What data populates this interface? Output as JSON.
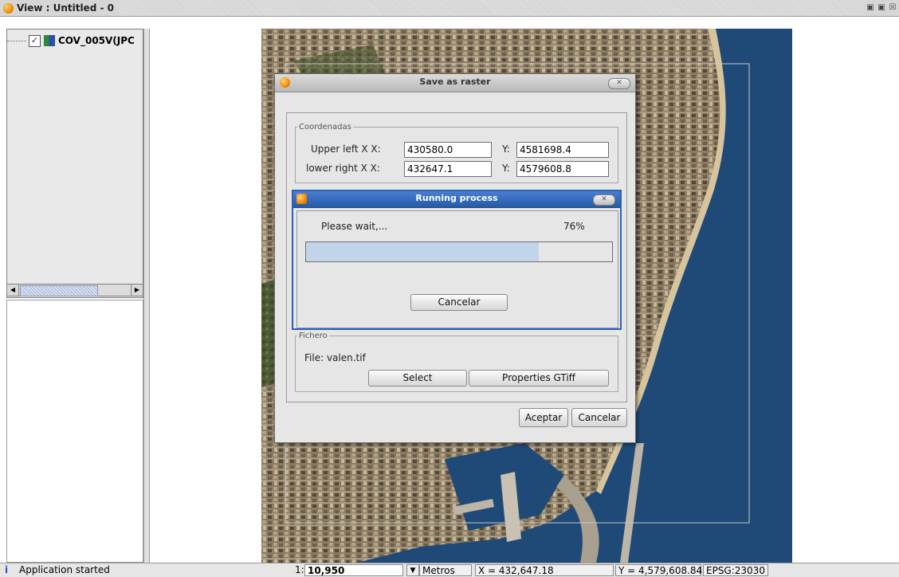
{
  "window": {
    "title": "View : Untitled - 0",
    "controls": [
      "minimize-icon",
      "maximize-icon",
      "close-icon"
    ]
  },
  "toc": {
    "layers": [
      {
        "label": "COV_005V(JPC",
        "checked": true
      }
    ]
  },
  "save_dialog": {
    "title": "Save as raster",
    "coords": {
      "legend": "Coordenadas",
      "upper_left_label": "Upper left X X:",
      "upper_left_x": "430580.0",
      "upper_left_y_label": "Y:",
      "upper_left_y": "4581698.4",
      "lower_right_label": "lower right X X:",
      "lower_right_x": "432647.1",
      "lower_right_y_label": "Y:",
      "lower_right_y": "4579608.8"
    },
    "file": {
      "legend": "Fichero",
      "file_label": "File: valen.tif",
      "select_label": "Select",
      "properties_label": "Properties GTiff"
    },
    "accept_label": "Aceptar",
    "cancel_label": "Cancelar"
  },
  "process_dialog": {
    "title": "Running process",
    "message": "Please wait,...",
    "percent_text": "76%",
    "progress": 0.76,
    "cancel_label": "Cancelar"
  },
  "status": {
    "message": "Application started",
    "scale_prefix": "1:",
    "scale_value": "10,950",
    "units": "Metros",
    "x_coord": "X = 432,647.18",
    "y_coord": "Y = 4,579,608.84",
    "crs": "EPSG:23030"
  },
  "colors": {
    "sea": "#1f4a78",
    "progress_fill": "#c2d4ea",
    "active_title": "#245aa8"
  }
}
